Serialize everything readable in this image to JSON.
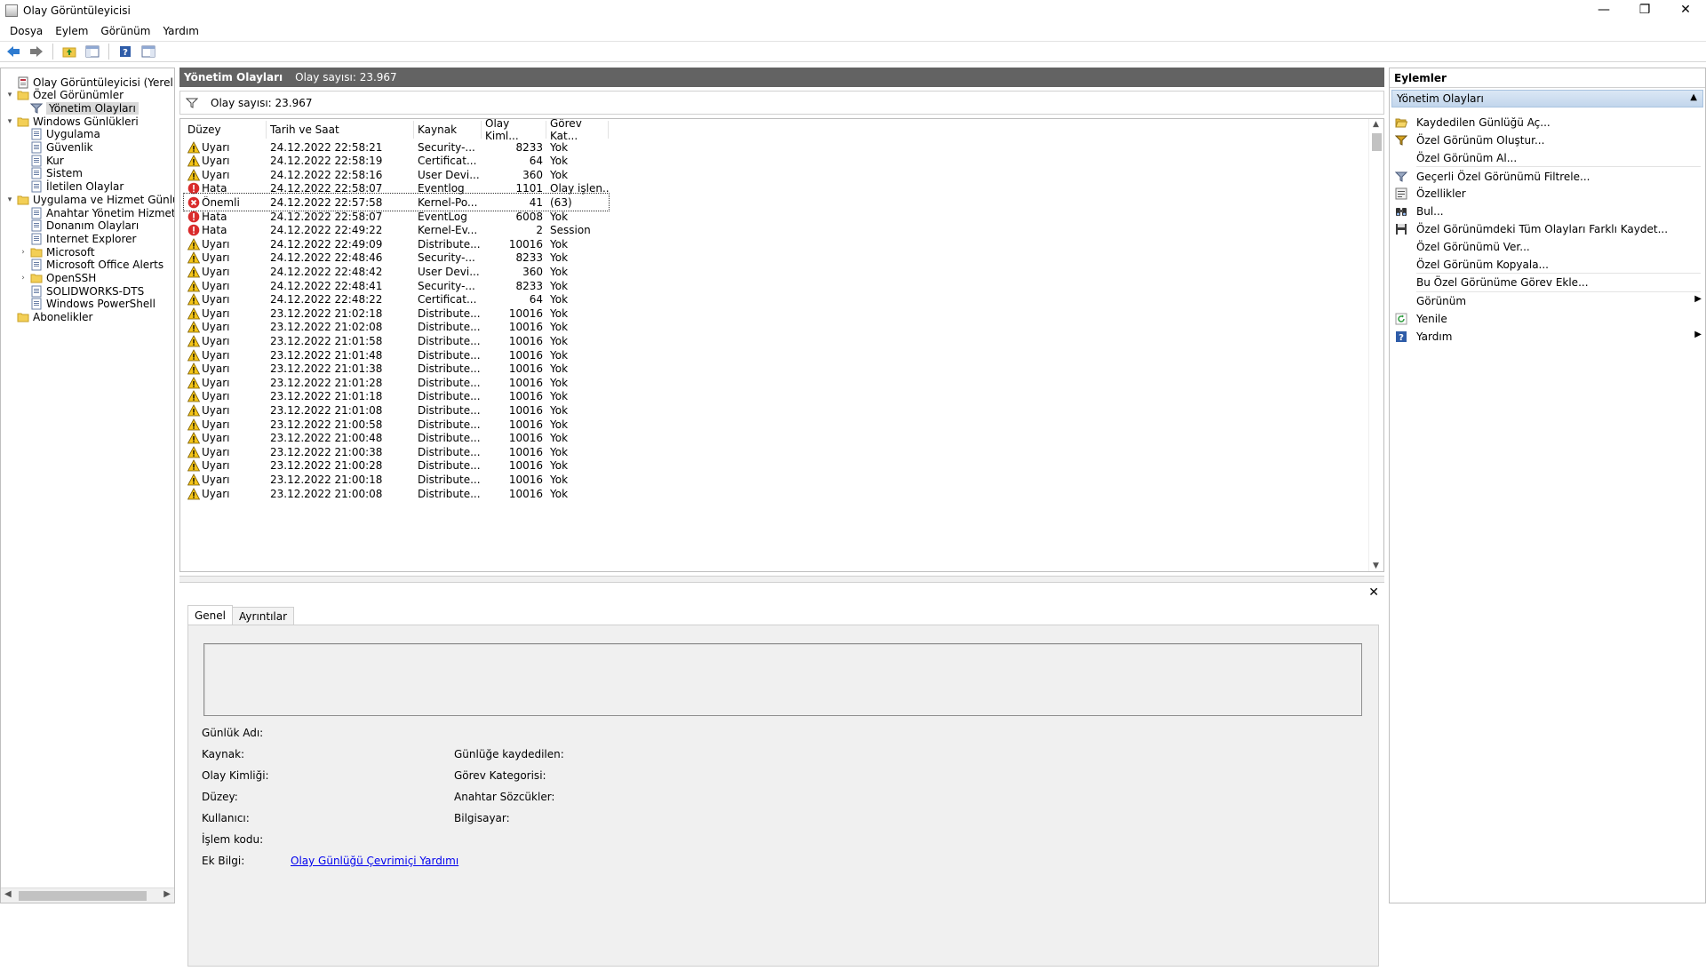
{
  "window": {
    "title": "Olay Görüntüleyicisi",
    "minimize": "—",
    "restore": "❐",
    "close": "✕"
  },
  "menu": [
    "Dosya",
    "Eylem",
    "Görünüm",
    "Yardım"
  ],
  "tree": [
    {
      "label": "Olay Görüntüleyicisi (Yerel)",
      "icon": "event-viewer-icon",
      "level": 0,
      "exp": ""
    },
    {
      "label": "Özel Görünümler",
      "icon": "folder-icon",
      "level": 0,
      "exp": "▾"
    },
    {
      "label": "Yönetim Olayları",
      "icon": "filter-icon",
      "level": 1,
      "exp": "",
      "selected": true
    },
    {
      "label": "Windows Günlükleri",
      "icon": "folder-icon",
      "level": 0,
      "exp": "▾"
    },
    {
      "label": "Uygulama",
      "icon": "log-icon",
      "level": 1,
      "exp": ""
    },
    {
      "label": "Güvenlik",
      "icon": "log-icon",
      "level": 1,
      "exp": ""
    },
    {
      "label": "Kur",
      "icon": "log-icon",
      "level": 1,
      "exp": ""
    },
    {
      "label": "Sistem",
      "icon": "log-icon",
      "level": 1,
      "exp": ""
    },
    {
      "label": "İletilen Olaylar",
      "icon": "log-icon",
      "level": 1,
      "exp": ""
    },
    {
      "label": "Uygulama ve Hizmet Günlük",
      "icon": "folder-icon",
      "level": 0,
      "exp": "▾"
    },
    {
      "label": "Anahtar Yönetim Hizmet",
      "icon": "log-icon",
      "level": 1,
      "exp": ""
    },
    {
      "label": "Donanım Olayları",
      "icon": "log-icon",
      "level": 1,
      "exp": ""
    },
    {
      "label": "Internet Explorer",
      "icon": "log-icon",
      "level": 1,
      "exp": ""
    },
    {
      "label": "Microsoft",
      "icon": "folder-icon",
      "level": 1,
      "exp": "›"
    },
    {
      "label": "Microsoft Office Alerts",
      "icon": "log-icon",
      "level": 1,
      "exp": ""
    },
    {
      "label": "OpenSSH",
      "icon": "folder-icon",
      "level": 1,
      "exp": "›"
    },
    {
      "label": "SOLIDWORKS-DTS",
      "icon": "log-icon",
      "level": 1,
      "exp": ""
    },
    {
      "label": "Windows PowerShell",
      "icon": "log-icon",
      "level": 1,
      "exp": ""
    },
    {
      "label": "Abonelikler",
      "icon": "folder-icon",
      "level": 0,
      "exp": ""
    }
  ],
  "center": {
    "title": "Yönetim Olayları",
    "count": "Olay sayısı: 23.967",
    "filter_text": "Olay sayısı: 23.967"
  },
  "grid": {
    "columns": [
      "Düzey",
      "Tarih ve Saat",
      "Kaynak",
      "Olay Kiml...",
      "Görev Kat..."
    ],
    "rows": [
      {
        "level": "Uyarı",
        "type": "warning",
        "date": "24.12.2022 22:58:21",
        "source": "Security-...",
        "id": "8233",
        "task": "Yok"
      },
      {
        "level": "Uyarı",
        "type": "warning",
        "date": "24.12.2022 22:58:19",
        "source": "Certificat...",
        "id": "64",
        "task": "Yok"
      },
      {
        "level": "Uyarı",
        "type": "warning",
        "date": "24.12.2022 22:58:16",
        "source": "User Devi...",
        "id": "360",
        "task": "Yok"
      },
      {
        "level": "Hata",
        "type": "error",
        "date": "24.12.2022 22:58:07",
        "source": "Eventlog",
        "id": "1101",
        "task": "Olay işlen..."
      },
      {
        "level": "Önemli",
        "type": "critical",
        "date": "24.12.2022 22:57:58",
        "source": "Kernel-Po...",
        "id": "41",
        "task": "(63)",
        "focus": true
      },
      {
        "level": "Hata",
        "type": "error",
        "date": "24.12.2022 22:58:07",
        "source": "EventLog",
        "id": "6008",
        "task": "Yok"
      },
      {
        "level": "Hata",
        "type": "error",
        "date": "24.12.2022 22:49:22",
        "source": "Kernel-Ev...",
        "id": "2",
        "task": "Session"
      },
      {
        "level": "Uyarı",
        "type": "warning",
        "date": "24.12.2022 22:49:09",
        "source": "Distribute...",
        "id": "10016",
        "task": "Yok"
      },
      {
        "level": "Uyarı",
        "type": "warning",
        "date": "24.12.2022 22:48:46",
        "source": "Security-...",
        "id": "8233",
        "task": "Yok"
      },
      {
        "level": "Uyarı",
        "type": "warning",
        "date": "24.12.2022 22:48:42",
        "source": "User Devi...",
        "id": "360",
        "task": "Yok"
      },
      {
        "level": "Uyarı",
        "type": "warning",
        "date": "24.12.2022 22:48:41",
        "source": "Security-...",
        "id": "8233",
        "task": "Yok"
      },
      {
        "level": "Uyarı",
        "type": "warning",
        "date": "24.12.2022 22:48:22",
        "source": "Certificat...",
        "id": "64",
        "task": "Yok"
      },
      {
        "level": "Uyarı",
        "type": "warning",
        "date": "23.12.2022 21:02:18",
        "source": "Distribute...",
        "id": "10016",
        "task": "Yok"
      },
      {
        "level": "Uyarı",
        "type": "warning",
        "date": "23.12.2022 21:02:08",
        "source": "Distribute...",
        "id": "10016",
        "task": "Yok"
      },
      {
        "level": "Uyarı",
        "type": "warning",
        "date": "23.12.2022 21:01:58",
        "source": "Distribute...",
        "id": "10016",
        "task": "Yok"
      },
      {
        "level": "Uyarı",
        "type": "warning",
        "date": "23.12.2022 21:01:48",
        "source": "Distribute...",
        "id": "10016",
        "task": "Yok"
      },
      {
        "level": "Uyarı",
        "type": "warning",
        "date": "23.12.2022 21:01:38",
        "source": "Distribute...",
        "id": "10016",
        "task": "Yok"
      },
      {
        "level": "Uyarı",
        "type": "warning",
        "date": "23.12.2022 21:01:28",
        "source": "Distribute...",
        "id": "10016",
        "task": "Yok"
      },
      {
        "level": "Uyarı",
        "type": "warning",
        "date": "23.12.2022 21:01:18",
        "source": "Distribute...",
        "id": "10016",
        "task": "Yok"
      },
      {
        "level": "Uyarı",
        "type": "warning",
        "date": "23.12.2022 21:01:08",
        "source": "Distribute...",
        "id": "10016",
        "task": "Yok"
      },
      {
        "level": "Uyarı",
        "type": "warning",
        "date": "23.12.2022 21:00:58",
        "source": "Distribute...",
        "id": "10016",
        "task": "Yok"
      },
      {
        "level": "Uyarı",
        "type": "warning",
        "date": "23.12.2022 21:00:48",
        "source": "Distribute...",
        "id": "10016",
        "task": "Yok"
      },
      {
        "level": "Uyarı",
        "type": "warning",
        "date": "23.12.2022 21:00:38",
        "source": "Distribute...",
        "id": "10016",
        "task": "Yok"
      },
      {
        "level": "Uyarı",
        "type": "warning",
        "date": "23.12.2022 21:00:28",
        "source": "Distribute...",
        "id": "10016",
        "task": "Yok"
      },
      {
        "level": "Uyarı",
        "type": "warning",
        "date": "23.12.2022 21:00:18",
        "source": "Distribute...",
        "id": "10016",
        "task": "Yok"
      },
      {
        "level": "Uyarı",
        "type": "warning",
        "date": "23.12.2022 21:00:08",
        "source": "Distribute...",
        "id": "10016",
        "task": "Yok"
      }
    ]
  },
  "details": {
    "tabs": [
      "Genel",
      "Ayrıntılar"
    ],
    "left_fields": [
      "Günlük Adı:",
      "Kaynak:",
      "Olay Kimliği:",
      "Düzey:",
      "Kullanıcı:",
      "İşlem kodu:",
      "Ek Bilgi:"
    ],
    "right_fields": [
      "Günlüğe kaydedilen:",
      "Görev Kategorisi:",
      "Anahtar Sözcükler:",
      "Bilgisayar:"
    ],
    "link": "Olay Günlüğü Çevrimiçi Yardımı",
    "close": "✕"
  },
  "actions": {
    "header": "Eylemler",
    "section": "Yönetim Olayları",
    "items": [
      {
        "label": "Kaydedilen Günlüğü Aç...",
        "icon": "open-folder-icon"
      },
      {
        "label": "Özel Görünüm Oluştur...",
        "icon": "create-filter-icon"
      },
      {
        "label": "Özel Görünüm Al...",
        "icon": ""
      },
      {
        "label": "Geçerli Özel Görünümü Filtrele...",
        "icon": "filter-icon"
      },
      {
        "label": "Özellikler",
        "icon": "properties-icon"
      },
      {
        "label": "Bul...",
        "icon": "binoculars-icon"
      },
      {
        "label": "Özel Görünümdeki Tüm Olayları Farklı Kaydet...",
        "icon": "save-icon"
      },
      {
        "label": "Özel Görünümü Ver...",
        "icon": ""
      },
      {
        "label": "Özel Görünüm Kopyala...",
        "icon": ""
      },
      {
        "label": "Bu Özel Görünüme Görev Ekle...",
        "icon": ""
      },
      {
        "label": "Görünüm",
        "icon": "",
        "submenu": true
      },
      {
        "label": "Yenile",
        "icon": "refresh-icon"
      },
      {
        "label": "Yardım",
        "icon": "help-icon",
        "submenu": true
      }
    ]
  }
}
